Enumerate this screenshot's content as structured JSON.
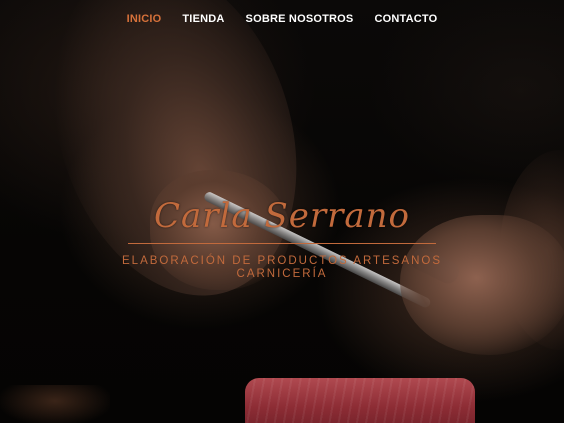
{
  "nav": {
    "items": [
      {
        "label": "INICIO",
        "active": true
      },
      {
        "label": "TIENDA",
        "active": false
      },
      {
        "label": "SOBRE NOSOTROS",
        "active": false
      },
      {
        "label": "CONTACTO",
        "active": false
      }
    ]
  },
  "hero": {
    "brand_name": "Carla Serrano",
    "tagline": "ELABORACIÓN DE PRODUCTOS ARTESANOS",
    "subtitle": "CARNICERÍA"
  },
  "colors": {
    "accent": "#d6713a",
    "brand": "#c26a3c",
    "nav_text": "#ffffff",
    "background": "#070605"
  }
}
